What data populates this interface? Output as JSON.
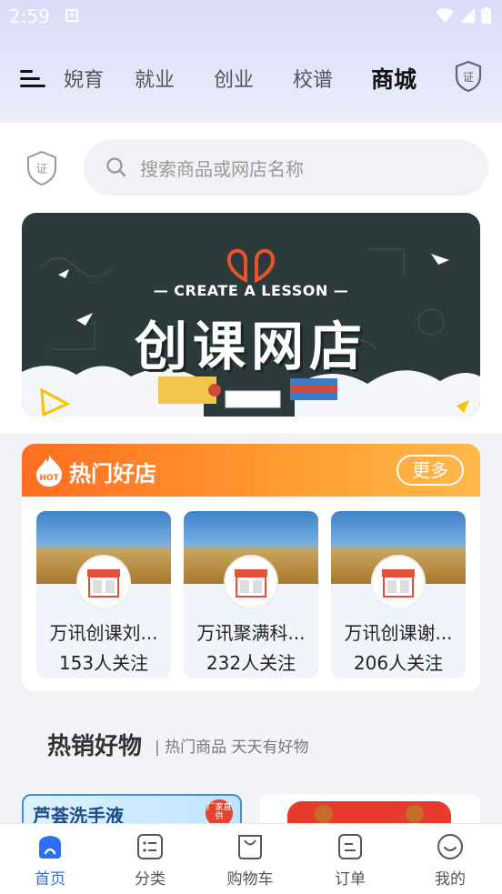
{
  "status_bar": {
    "time": "2:59",
    "a_badge": "A"
  },
  "top_nav": {
    "tabs": [
      {
        "label": "婗育",
        "active": false
      },
      {
        "label": "就业",
        "active": false
      },
      {
        "label": "创业",
        "active": false
      },
      {
        "label": "校谱",
        "active": false
      },
      {
        "label": "商城",
        "active": true
      }
    ],
    "badge_text": "证"
  },
  "search": {
    "badge_text": "证",
    "placeholder": "搜索商品或网店名称"
  },
  "banner": {
    "subtitle": "— CREATE A LESSON —",
    "title": "创课网店"
  },
  "hot_shops": {
    "badge": "HOT",
    "title": "热门好店",
    "more_label": "更多",
    "items": [
      {
        "name": "万讯创课刘...",
        "followers": "153人关注"
      },
      {
        "name": "万讯聚满科...",
        "followers": "232人关注"
      },
      {
        "name": "万讯创课谢...",
        "followers": "206人关注"
      }
    ]
  },
  "hot_goods": {
    "title": "热销好物",
    "subtitle": "| 热门商品 天天有好物",
    "items": [
      {
        "text": "芦荟洗手液",
        "tag": "厂家直供"
      },
      {
        "text": ""
      }
    ]
  },
  "bottom_nav": {
    "items": [
      {
        "label": "首页",
        "active": true
      },
      {
        "label": "分类",
        "active": false
      },
      {
        "label": "购物车",
        "active": false
      },
      {
        "label": "订单",
        "active": false
      },
      {
        "label": "我的",
        "active": false
      }
    ]
  },
  "colors": {
    "accent": "#2f6ef0",
    "hot_orange": "#ff7a22",
    "banner_bg": "#2c3a3b"
  }
}
